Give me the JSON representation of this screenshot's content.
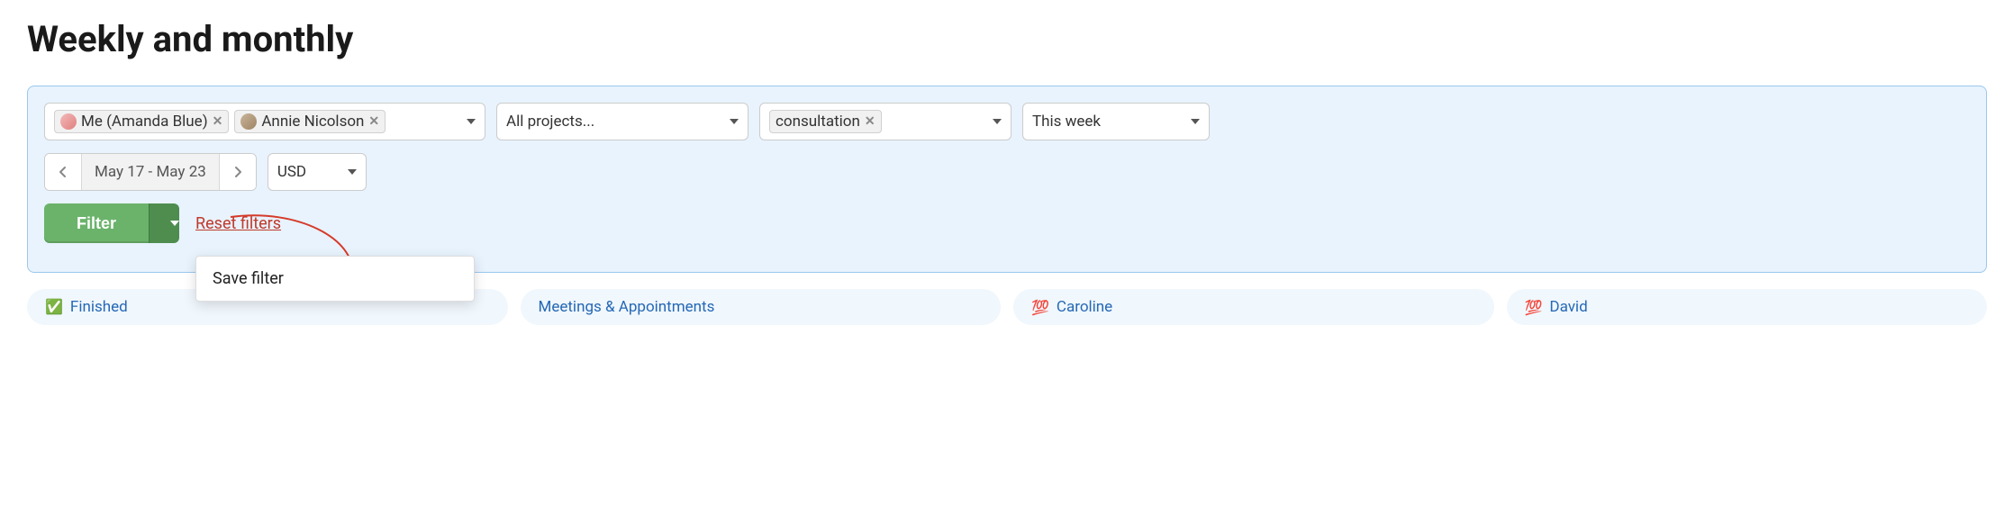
{
  "header": {
    "title": "Weekly and monthly"
  },
  "filters": {
    "people": {
      "chips": [
        {
          "label": "Me (Amanda Blue)",
          "avatar_color": "linear-gradient(135deg,#f3b9b9,#e07f7f)"
        },
        {
          "label": "Annie Nicolson",
          "avatar_color": "linear-gradient(135deg,#c9b59b,#9e8362)"
        }
      ]
    },
    "projects": {
      "placeholder": "All projects..."
    },
    "tags": {
      "chips": [
        {
          "label": "consultation"
        }
      ]
    },
    "period": {
      "placeholder": "This week"
    },
    "date_range": "May 17 - May 23",
    "currency": "USD"
  },
  "actions": {
    "filter_label": "Filter",
    "reset_label": "Reset filters",
    "dropdown": {
      "save_filter": "Save filter"
    }
  },
  "pills": {
    "finished": {
      "icon": "✅",
      "label": "Finished"
    },
    "meetings": {
      "label": "Meetings & Appointments"
    },
    "caroline": {
      "icon": "💯",
      "label": "Caroline"
    },
    "david": {
      "icon": "💯",
      "label": "David"
    }
  }
}
